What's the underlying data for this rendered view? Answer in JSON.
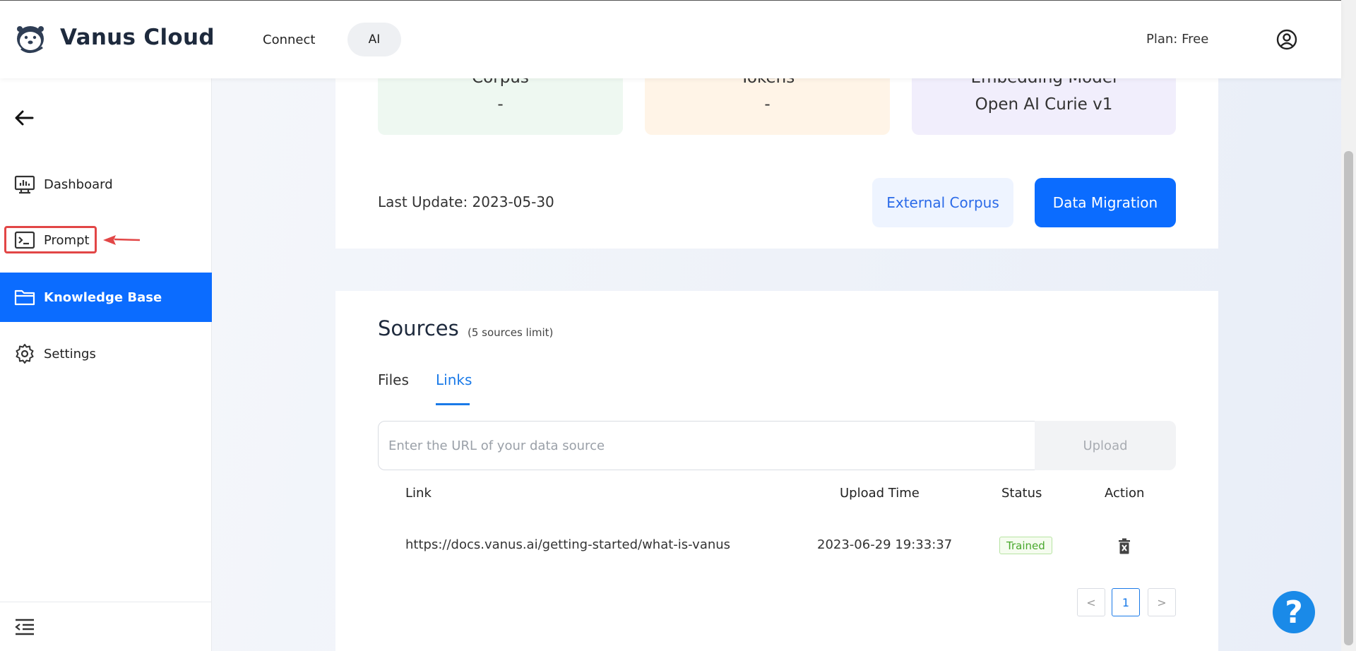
{
  "header": {
    "app_title": "Vanus Cloud",
    "nav": [
      {
        "label": "Connect",
        "active": false
      },
      {
        "label": "AI",
        "active": true
      }
    ],
    "plan": "Plan: Free"
  },
  "sidebar": {
    "items": [
      {
        "label": "Dashboard",
        "icon": "dashboard-icon"
      },
      {
        "label": "Prompt",
        "icon": "terminal-icon"
      },
      {
        "label": "Knowledge Base",
        "icon": "folder-icon",
        "active": true
      },
      {
        "label": "Settings",
        "icon": "gear-icon"
      }
    ]
  },
  "stats": {
    "corpus": {
      "label": "Corpus",
      "value": "-"
    },
    "tokens": {
      "label": "Tokens",
      "value": "-"
    },
    "model": {
      "label": "Embedding Model",
      "value": "Open AI Curie v1"
    }
  },
  "last_update": "Last Update: 2023-05-30",
  "buttons": {
    "external_corpus": "External Corpus",
    "data_migration": "Data Migration",
    "upload": "Upload"
  },
  "sources": {
    "title": "Sources",
    "limit": "(5 sources limit)",
    "tabs": [
      "Files",
      "Links"
    ],
    "active_tab": "Links",
    "input_placeholder": "Enter the URL of your data source",
    "columns": [
      "Link",
      "Upload Time",
      "Status",
      "Action"
    ],
    "rows": [
      {
        "link": "https://docs.vanus.ai/getting-started/what-is-vanus",
        "upload_time": "2023-06-29 19:33:37",
        "status": "Trained"
      }
    ]
  },
  "pagination": {
    "prev": "<",
    "current": "1",
    "next": ">"
  },
  "help": "?",
  "colors": {
    "primary": "#0b6cff",
    "link_blue": "#1a7ae8",
    "highlight_red": "#e24646",
    "status_green": "#49a82d"
  }
}
